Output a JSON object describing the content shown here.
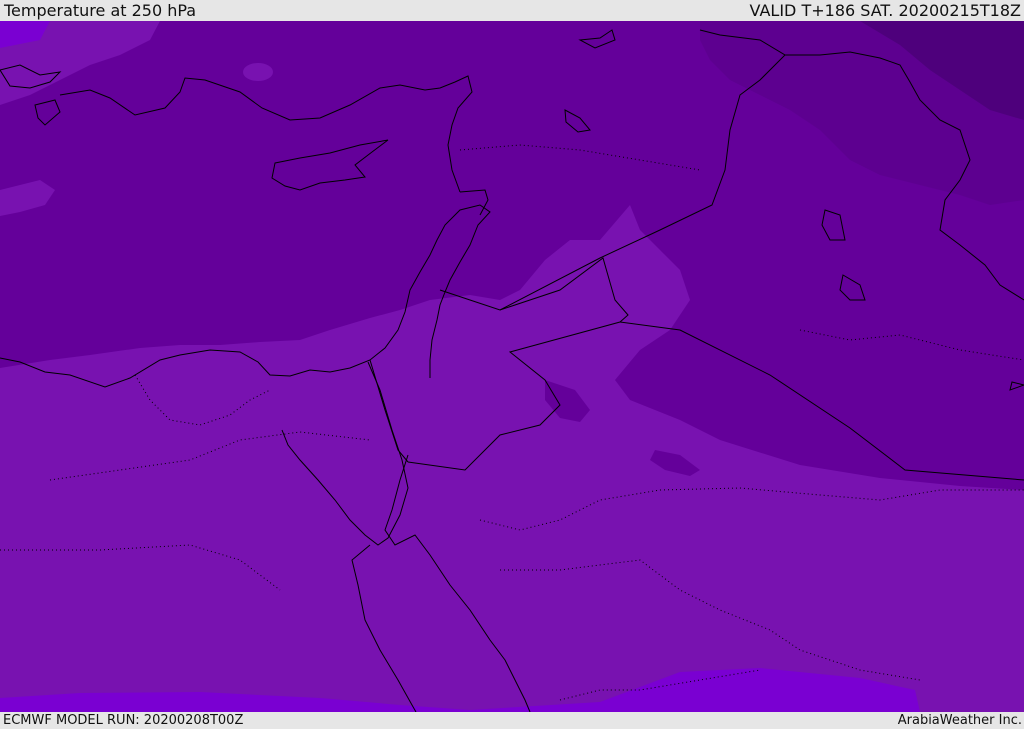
{
  "header": {
    "title": "Temperature at 250 hPa",
    "valid": "VALID T+186 SAT. 20200215T18Z"
  },
  "footer": {
    "model_run": "ECMWF MODEL RUN: 20200208T00Z",
    "credit": "ArabiaWeather Inc."
  },
  "colors": {
    "band_coldest": "#4e007c",
    "band_cold": "#5d0090",
    "band_cool": "#64009a",
    "band_mid": "#7812b0",
    "band_warm": "#7a00d2",
    "coast_line": "#000000",
    "border_line": "#000000"
  }
}
